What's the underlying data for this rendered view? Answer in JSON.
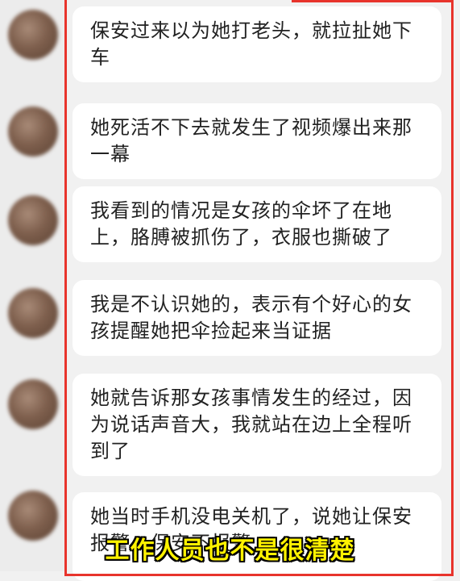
{
  "messages": [
    {
      "text": "保安过来以为她打老头，就拉扯她下车"
    },
    {
      "text": "她死活不下去就发生了视频爆出来那一幕"
    },
    {
      "text": "我看到的情况是女孩的伞坏了在地上，胳膊被抓伤了，衣服也撕破了"
    },
    {
      "text": "我是不认识她的，表示有个好心的女孩提醒她把伞捡起来当证据"
    },
    {
      "text": "她就告诉那女孩事情发生的经过，因为说话声音大，我就站在边上全程听到了"
    },
    {
      "text": "她当时手机没电关机了，说她让保安报警，保安不报警"
    }
  ],
  "subtitle": "工作人员也不是很清楚",
  "colors": {
    "frame": "#e8342c",
    "subtitle": "#fff200",
    "bubble": "#ffffff",
    "background": "#f1f1f1"
  }
}
